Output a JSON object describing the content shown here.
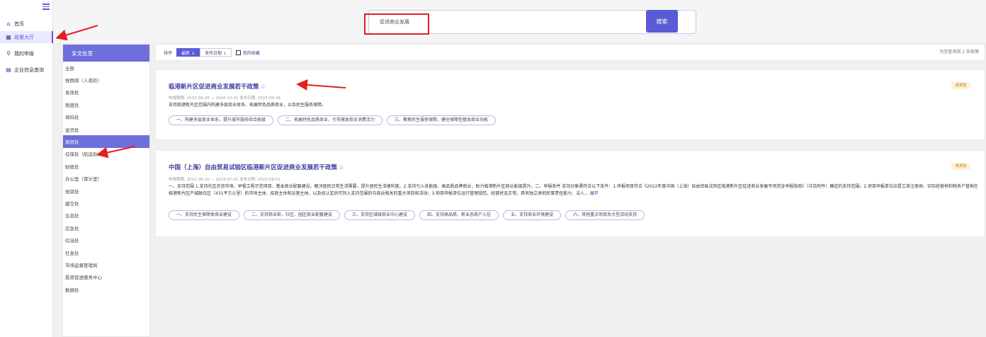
{
  "sidebar": {
    "items": [
      {
        "icon": "home-icon",
        "glyph": "⌂",
        "label": "首页"
      },
      {
        "icon": "grid-icon",
        "glyph": "▦",
        "label": "政策大厅",
        "active": true
      },
      {
        "icon": "search-icon",
        "glyph": "⚲",
        "label": "我的申报"
      },
      {
        "icon": "document-icon",
        "glyph": "▤",
        "label": "企业信息查询"
      }
    ]
  },
  "search": {
    "value": "促进商业发展",
    "button_label": "搜索"
  },
  "departments": {
    "header": "发文处室",
    "items": [
      "全部",
      "党群部（人资处）",
      "发改处",
      "制度处",
      "商科处",
      "金贸处",
      "商贸处",
      "综保处（航运处）",
      "财政处",
      "办公室（审计室）",
      "规资处",
      "建交处",
      "生态处",
      "应急处",
      "综治处",
      "社发处",
      "市场监督管理局",
      "投资促进服务中心",
      "数据处"
    ],
    "active_index": 6
  },
  "filter": {
    "sort_label": "排序",
    "newest_label": "最新 ↓",
    "date_label": "发布日期 ↓",
    "favorites_label": "我的收藏",
    "result_count": "为您查询到 2 条政策"
  },
  "cards": [
    {
      "title": "临港新片区促进商业发展若干政策",
      "star": "☆",
      "meta": "申报期限: 2023-09-26 — 2026-12-31 发布日期: 2023-09-26",
      "desc": "支持临港新片区范围内构建多层商业体系、拓展特色品质商业，以及民生服务保障。",
      "badge": "商贸处",
      "tags": [
        "一、构建多层商业体系，提升城市服务综合能级",
        "二、拓展特色品质商业，引导激发商业消费活力",
        "三、聚焦民生服务保障，健全保障型基本商业功能"
      ]
    },
    {
      "title": "中国（上海）自由贸易试验区临港新片区促进商业发展若干政策",
      "star": "☆",
      "meta": "申报期限: 2022-06-10 — 2023-07-01 发布日期: 2022-08-01",
      "desc": "一、支持范围 1.支持社区农贸市场、早餐工程示范项目、基本商业配套建设，解决居民日常生活需要，提升居民生活便利度。2.支持引入各能级、高品质品牌商业，助力临港新片区商业能级提升。二、申报条件 支持对象需符合以下条件：1.申报项目符合《2022年度中国（上海）自由贸易试验区临港新片区促进商业发展专项资金申报指南》（详见附件）确定的支持范围；2.项目申报单位应是工商注册地、实际经营地和税务户管地在临港新片区产城融合区（431平方公里）的市场主体、招商主体和运营主体，以及经认定后可列入支持范围的与商业相关的重大项目和活动；3.项目申报单位运行管理规范，经营状态正常，具有独立承担民事责任能力、法人...",
      "more": "展开",
      "badge": "商贸处",
      "tags": [
        "一、支持民生保障类商业建设",
        "二、支持商业街、社区、园区商业配套建设",
        "三、支持区域级商业中心建设",
        "四、支持高品质、新业态商户入驻",
        "五、支持商业环境建设",
        "六、其他重点项目及大型活动支持"
      ]
    }
  ],
  "colors": {
    "accent": "#5b5bd6",
    "title": "#3d3d9e",
    "annotation": "#e02020",
    "badge_bg": "#fff1d9"
  }
}
